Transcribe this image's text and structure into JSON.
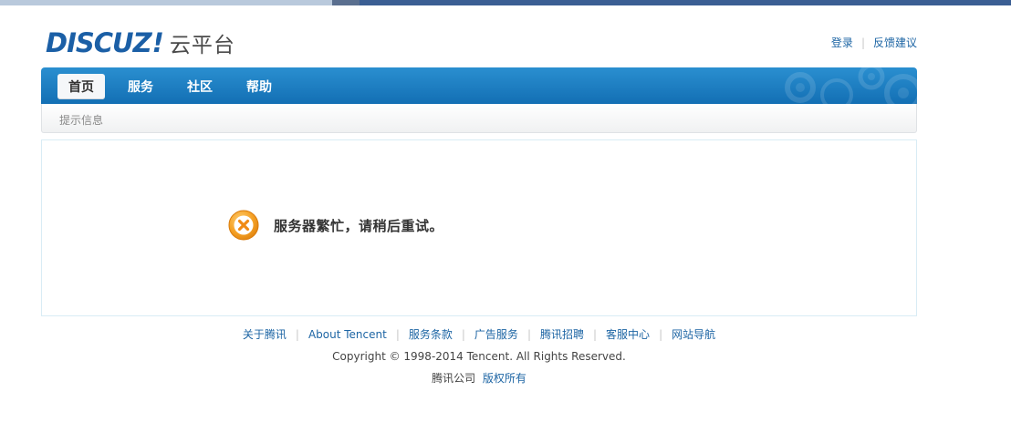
{
  "header": {
    "logo_mark": "DISCUZ",
    "logo_bang": "!",
    "logo_cloud": "云平台",
    "links": [
      {
        "label": "登录"
      },
      {
        "label": "反馈建议"
      }
    ]
  },
  "nav": {
    "items": [
      {
        "label": "首页",
        "active": true
      },
      {
        "label": "服务",
        "active": false
      },
      {
        "label": "社区",
        "active": false
      },
      {
        "label": "帮助",
        "active": false
      }
    ]
  },
  "breadcrumb": {
    "label": "提示信息"
  },
  "message": {
    "icon": "error-x-icon",
    "text": "服务器繁忙，请稍后重试。"
  },
  "footer": {
    "links": [
      {
        "label": "关于腾讯"
      },
      {
        "label": "About Tencent"
      },
      {
        "label": "服务条款"
      },
      {
        "label": "广告服务"
      },
      {
        "label": "腾讯招聘"
      },
      {
        "label": "客服中心"
      },
      {
        "label": "网站导航"
      }
    ],
    "copyright": "Copyright © 1998-2014 Tencent. All Rights Reserved.",
    "company": "腾讯公司",
    "rights": "版权所有"
  },
  "colors": {
    "brand_blue": "#1b5fa6",
    "nav_blue": "#136fb4",
    "link_blue": "#1d65a4",
    "error_orange": "#f29a1f"
  }
}
